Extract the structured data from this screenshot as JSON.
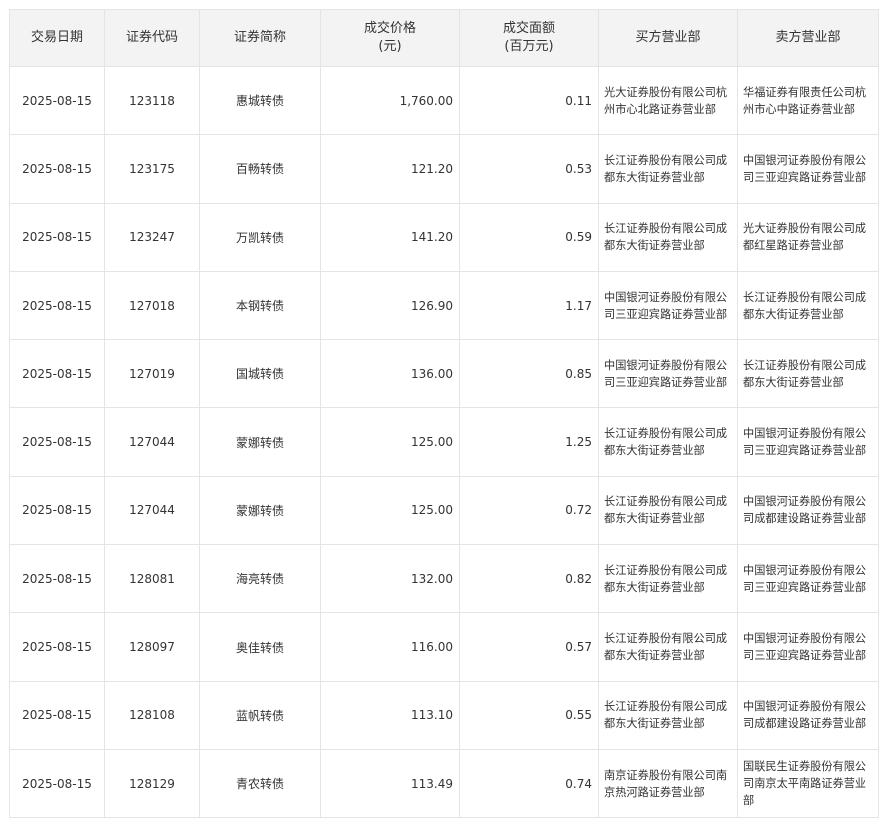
{
  "table": {
    "headers": {
      "date": "交易日期",
      "code": "证券代码",
      "name": "证券简称",
      "price_label": "成交价格",
      "price_unit": "(元)",
      "amount_label": "成交面额",
      "amount_unit": "(百万元)",
      "buyer": "买方营业部",
      "seller": "卖方营业部"
    },
    "rows": [
      {
        "date": "2025-08-15",
        "code": "123118",
        "name": "惠城转债",
        "price": "1,760.00",
        "amount": "0.11",
        "buyer": "光大证券股份有限公司杭州市心北路证券营业部",
        "seller": "华福证券有限责任公司杭州市心中路证券营业部"
      },
      {
        "date": "2025-08-15",
        "code": "123175",
        "name": "百畅转债",
        "price": "121.20",
        "amount": "0.53",
        "buyer": "长江证券股份有限公司成都东大街证券营业部",
        "seller": "中国银河证券股份有限公司三亚迎宾路证券营业部"
      },
      {
        "date": "2025-08-15",
        "code": "123247",
        "name": "万凯转债",
        "price": "141.20",
        "amount": "0.59",
        "buyer": "长江证券股份有限公司成都东大街证券营业部",
        "seller": "光大证券股份有限公司成都红星路证券营业部"
      },
      {
        "date": "2025-08-15",
        "code": "127018",
        "name": "本钢转债",
        "price": "126.90",
        "amount": "1.17",
        "buyer": "中国银河证券股份有限公司三亚迎宾路证券营业部",
        "seller": "长江证券股份有限公司成都东大街证券营业部"
      },
      {
        "date": "2025-08-15",
        "code": "127019",
        "name": "国城转债",
        "price": "136.00",
        "amount": "0.85",
        "buyer": "中国银河证券股份有限公司三亚迎宾路证券营业部",
        "seller": "长江证券股份有限公司成都东大街证券营业部"
      },
      {
        "date": "2025-08-15",
        "code": "127044",
        "name": "蒙娜转债",
        "price": "125.00",
        "amount": "1.25",
        "buyer": "长江证券股份有限公司成都东大街证券营业部",
        "seller": "中国银河证券股份有限公司三亚迎宾路证券营业部"
      },
      {
        "date": "2025-08-15",
        "code": "127044",
        "name": "蒙娜转债",
        "price": "125.00",
        "amount": "0.72",
        "buyer": "长江证券股份有限公司成都东大街证券营业部",
        "seller": "中国银河证券股份有限公司成都建设路证券营业部"
      },
      {
        "date": "2025-08-15",
        "code": "128081",
        "name": "海亮转债",
        "price": "132.00",
        "amount": "0.82",
        "buyer": "长江证券股份有限公司成都东大街证券营业部",
        "seller": "中国银河证券股份有限公司三亚迎宾路证券营业部"
      },
      {
        "date": "2025-08-15",
        "code": "128097",
        "name": "奥佳转债",
        "price": "116.00",
        "amount": "0.57",
        "buyer": "长江证券股份有限公司成都东大街证券营业部",
        "seller": "中国银河证券股份有限公司三亚迎宾路证券营业部"
      },
      {
        "date": "2025-08-15",
        "code": "128108",
        "name": "蓝帆转债",
        "price": "113.10",
        "amount": "0.55",
        "buyer": "长江证券股份有限公司成都东大街证券营业部",
        "seller": "中国银河证券股份有限公司成都建设路证券营业部"
      },
      {
        "date": "2025-08-15",
        "code": "128129",
        "name": "青农转债",
        "price": "113.49",
        "amount": "0.74",
        "buyer": "南京证券股份有限公司南京热河路证券营业部",
        "seller": "国联民生证券股份有限公司南京太平南路证券营业部"
      }
    ]
  }
}
